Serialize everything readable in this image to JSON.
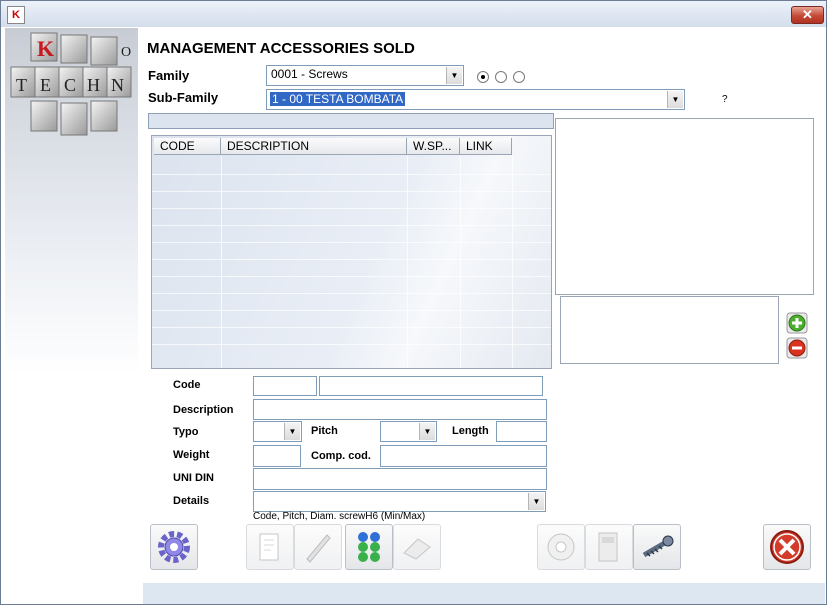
{
  "form": {
    "title": "MANAGEMENT ACCESSORIES SOLD",
    "family_label": "Family",
    "family_value": "0001 - Screws",
    "subfamily_label": "Sub-Family",
    "subfamily_value": "1 - 00 TESTA BOMBATA",
    "help_mark": "?"
  },
  "logo": {
    "letters": [
      "K",
      "T",
      "E",
      "C",
      "H",
      "N",
      "O"
    ]
  },
  "grid": {
    "columns": [
      "CODE",
      "DESCRIPTION",
      "W.SP...",
      "LINK"
    ],
    "rows": []
  },
  "detail": {
    "code_label": "Code",
    "code_value": "",
    "code_desc_value": "",
    "description_label": "Description",
    "description_value": "",
    "typo_label": "Typo",
    "typo_value": "",
    "pitch_label": "Pitch",
    "pitch_value": "",
    "length_label": "Length",
    "length_value": "",
    "weight_label": "Weight",
    "weight_value": "",
    "compcod_label": "Comp. cod.",
    "compcod_value": "",
    "unidin_label": "UNI DIN",
    "unidin_value": "",
    "details_label": "Details",
    "details_value": "",
    "hint": "Code, Pitch, Diam. screwH6 (Min/Max)"
  },
  "window": {
    "close_glyph": "✕"
  },
  "icons": {
    "settings": "gear-icon",
    "edit": "edit-page-icon",
    "pen": "pen-icon",
    "grid": "blocks-icon",
    "erase": "eraser-icon",
    "disk": "disk-icon",
    "machine": "machine-icon",
    "screw": "screw-icon",
    "exit": "exit-icon",
    "add": "plus-icon",
    "remove": "minus-icon"
  }
}
